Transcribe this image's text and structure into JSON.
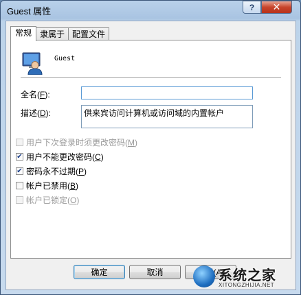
{
  "window": {
    "title": "Guest 属性"
  },
  "titlebar": {
    "help_label": "?",
    "close_label": "✕"
  },
  "tabs": [
    {
      "label": "常规",
      "active": true
    },
    {
      "label": "隶属于",
      "active": false
    },
    {
      "label": "配置文件",
      "active": false
    }
  ],
  "user": {
    "name": "Guest",
    "icon": "user-account-icon"
  },
  "fields": {
    "fullname_label_pre": "全名(",
    "fullname_key": "F",
    "fullname_label_post": "):",
    "fullname_value": "",
    "desc_label_pre": "描述(",
    "desc_key": "D",
    "desc_label_post": "):",
    "desc_value": "供来宾访问计算机或访问域的内置帐户"
  },
  "checkboxes": [
    {
      "label": "用户下次登录时须更改密码",
      "key": "M",
      "checked": false,
      "disabled": true
    },
    {
      "label": "用户不能更改密码",
      "key": "C",
      "checked": true,
      "disabled": false
    },
    {
      "label": "密码永不过期",
      "key": "P",
      "checked": true,
      "disabled": false
    },
    {
      "label": "帐户已禁用",
      "key": "B",
      "checked": false,
      "disabled": false
    },
    {
      "label": "帐户已锁定",
      "key": "O",
      "checked": false,
      "disabled": true
    }
  ],
  "buttons": {
    "ok": "确定",
    "cancel": "取消",
    "apply": "应用(A)"
  },
  "watermark": {
    "text": "系统之家",
    "url": "XITONGZHIJIA.NET"
  }
}
